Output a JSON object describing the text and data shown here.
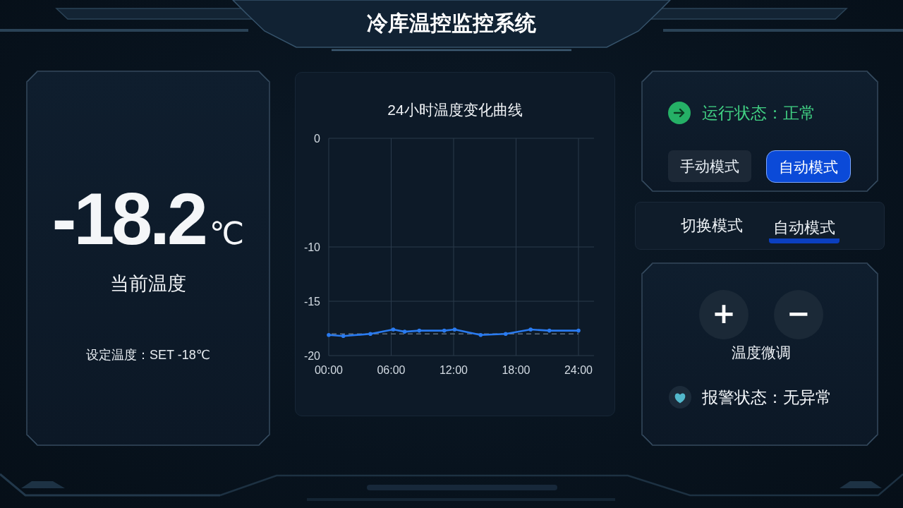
{
  "header": {
    "title": "冷库温控监控系统"
  },
  "current_temperature": {
    "value": "-18.2",
    "unit": "℃",
    "label": "当前温度",
    "setpoint": "设定温度：SET -18℃"
  },
  "trend_chart": {
    "chart_data": {
      "type": "line",
      "title": "24小时温度变化曲线",
      "x": [
        0,
        1.4,
        4,
        6.2,
        7.3,
        8.7,
        11.1,
        12.1,
        14.6,
        17,
        19.4,
        21.2,
        24
      ],
      "series": [
        {
          "color": "#2a7bf0",
          "values": [
            -18.1,
            -18.2,
            -18.0,
            -17.6,
            -17.8,
            -17.7,
            -17.7,
            -17.6,
            -18.1,
            -18.0,
            -17.6,
            -17.7,
            -17.7
          ]
        }
      ],
      "xlim": [
        0,
        24
      ],
      "ylim": [
        -20,
        0
      ],
      "xticks": [
        {
          "value": 0,
          "label": "00:00"
        },
        {
          "value": 6,
          "label": "06:00"
        },
        {
          "value": 12,
          "label": "12:00"
        },
        {
          "value": 18,
          "label": "18:00"
        },
        {
          "value": 24,
          "label": "24:00"
        }
      ],
      "yticks": [
        0,
        -10,
        -15,
        -20
      ],
      "grid": true,
      "ref_lines": [
        {
          "axis": "y",
          "value": -18
        }
      ]
    }
  },
  "run_status": {
    "text": "运行状态：正常"
  },
  "mode_buttons": [
    {
      "label": "手动模式",
      "selected": false
    },
    {
      "label": "自动模式",
      "selected": true
    }
  ],
  "mode_switch": {
    "label": "切换模式",
    "value": "自动模式"
  },
  "fine_adjust": {
    "buttons": [
      "+",
      "−"
    ],
    "label": "温度微调"
  },
  "alarm_status": {
    "text": "报警状态：无异常"
  }
}
